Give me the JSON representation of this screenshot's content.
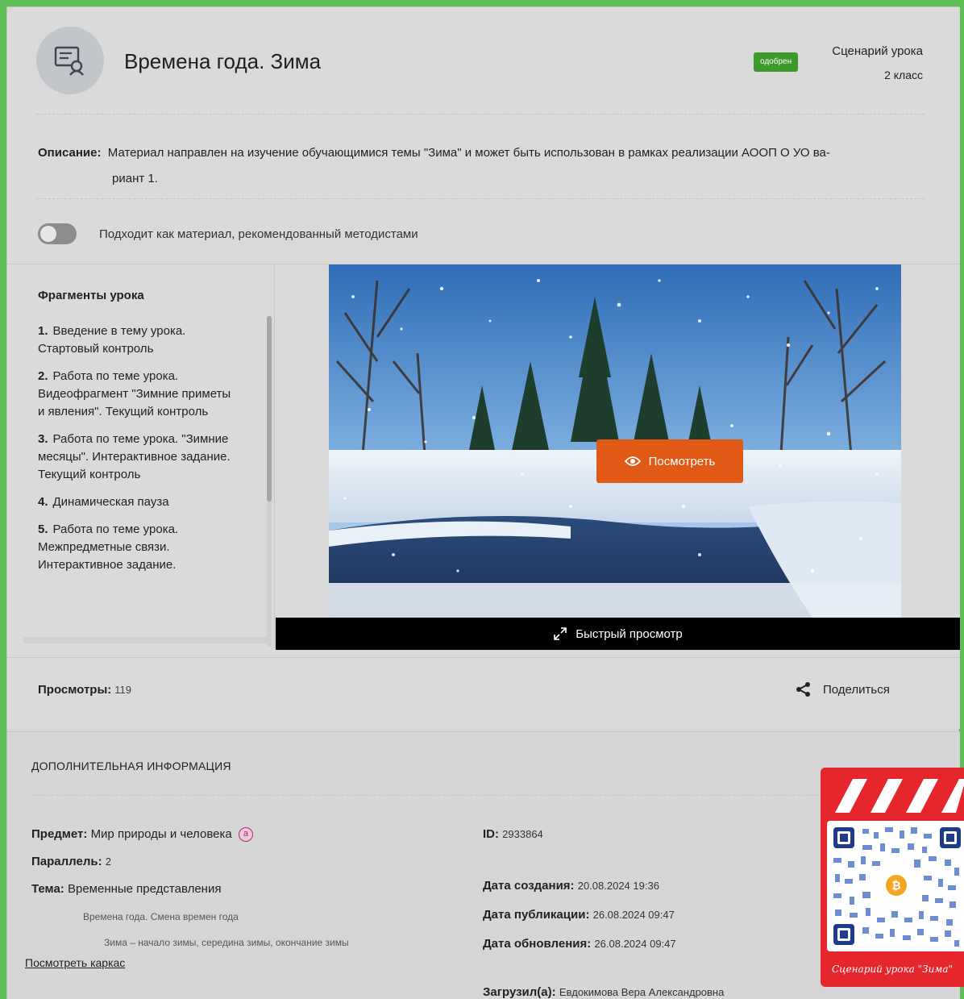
{
  "header": {
    "title": "Времена года. Зима",
    "status_badge": "одобрен",
    "material_type": "Сценарий урока",
    "grade": "2 класс"
  },
  "description": {
    "label": "Описание:",
    "line1": "Материал направлен на изучение обучающимися темы \"Зима\" и может быть использован в рамках реализации АООП О УО ва-",
    "line2": "риант 1."
  },
  "toggle": {
    "label": "Подходит как материал, рекомендованный методистами",
    "state": "off"
  },
  "fragments": {
    "heading": "Фрагменты урока",
    "items": [
      {
        "num": "1.",
        "text": "Введение в тему урока. Стартовый контроль"
      },
      {
        "num": "2.",
        "text": "Работа по теме урока. Видеофрагмент \"Зимние приметы и явления\". Текущий контроль"
      },
      {
        "num": "3.",
        "text": "Работа по теме урока. \"Зимние месяцы\". Интерактивное задание. Текущий контроль"
      },
      {
        "num": "4.",
        "text": "Динамическая пауза"
      },
      {
        "num": "5.",
        "text": "Работа по теме урока. Межпредметные связи. Интерактивное задание."
      }
    ]
  },
  "preview": {
    "view_button": "Посмотреть",
    "quick_view": "Быстрый просмотр"
  },
  "stats": {
    "views_label": "Просмотры:",
    "views_count": "119",
    "share_label": "Поделиться"
  },
  "additional": {
    "section_title": "ДОПОЛНИТЕЛЬНАЯ ИНФОРМАЦИЯ",
    "subject_label": "Предмет:",
    "subject_value": "Мир природы и человека",
    "subject_badge": "a",
    "parallel_label": "Параллель:",
    "parallel_value": "2",
    "topic_label": "Тема:",
    "topic_value": "Временные представления",
    "topic_sub1": "Времена года. Смена времен года",
    "topic_sub2": "Зима – начало зимы, середина зимы, окончание зимы",
    "frame_link": "Посмотреть каркас",
    "id_label": "ID:",
    "id_value": "2933864",
    "created_label": "Дата создания:",
    "created_value": "20.08.2024 19:36",
    "published_label": "Дата публикации:",
    "published_value": "26.08.2024 09:47",
    "updated_label": "Дата обновления:",
    "updated_value": "26.08.2024 09:47",
    "uploader_label": "Загрузил(а):",
    "uploader_value": "Евдокимова Вера Александровна"
  },
  "qr": {
    "caption": "Сценарий урока \"Зима\""
  },
  "colors": {
    "accent_orange": "#e05a16",
    "badge_green": "#3c9a2a",
    "qr_red": "#e5262c",
    "border_green": "#5fbf57"
  }
}
